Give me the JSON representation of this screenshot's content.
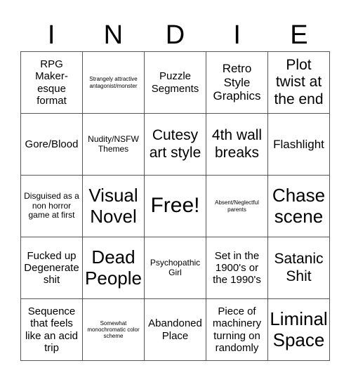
{
  "header": {
    "letters": [
      "I",
      "N",
      "D",
      "I",
      "E"
    ]
  },
  "cells": [
    {
      "text": "RPG Maker-esque format",
      "size": "s-md"
    },
    {
      "text": "Strangely attractive antagonist/monster",
      "size": "s-xs"
    },
    {
      "text": "Puzzle Segments",
      "size": "s-md"
    },
    {
      "text": "Retro Style Graphics",
      "size": "s-lg"
    },
    {
      "text": "Plot twist at the end",
      "size": "s-xl"
    },
    {
      "text": "Gore/Blood",
      "size": "s-md"
    },
    {
      "text": "Nudity/NSFW Themes",
      "size": "s-sm"
    },
    {
      "text": "Cutesy art style",
      "size": "s-xl"
    },
    {
      "text": "4th wall breaks",
      "size": "s-xl"
    },
    {
      "text": "Flashlight",
      "size": "s-lg"
    },
    {
      "text": "Disguised as a non horror game at first",
      "size": "s-sm"
    },
    {
      "text": "Visual Novel",
      "size": "s-xxl"
    },
    {
      "text": "Free!",
      "size": "s-free"
    },
    {
      "text": "Absent/Neglectful parents",
      "size": "s-xs"
    },
    {
      "text": "Chase scene",
      "size": "s-xxl"
    },
    {
      "text": "Fucked up Degenerate shit",
      "size": "s-md"
    },
    {
      "text": "Dead People",
      "size": "s-xxl"
    },
    {
      "text": "Psychopathic Girl",
      "size": "s-sm"
    },
    {
      "text": "Set in the 1900's or the 1990's",
      "size": "s-md"
    },
    {
      "text": "Satanic Shit",
      "size": "s-xl"
    },
    {
      "text": "Sequence that feels like an acid trip",
      "size": "s-md"
    },
    {
      "text": "Somewhat monochromatic color scheme",
      "size": "s-xs"
    },
    {
      "text": "Abandoned Place",
      "size": "s-md"
    },
    {
      "text": "Piece of machinery turning on randomly",
      "size": "s-md"
    },
    {
      "text": "Liminal Space",
      "size": "s-xxl"
    }
  ]
}
